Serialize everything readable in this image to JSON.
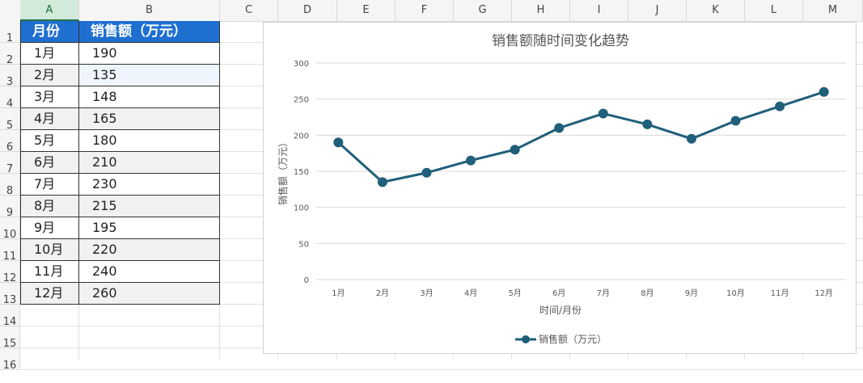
{
  "sheet": {
    "columns": [
      "A",
      "B",
      "C",
      "D",
      "E",
      "F",
      "G",
      "H",
      "I",
      "J",
      "K",
      "L",
      "M"
    ],
    "rows": [
      "1",
      "2",
      "3",
      "4",
      "5",
      "6",
      "7",
      "8",
      "9",
      "10",
      "11",
      "12",
      "13",
      "14",
      "15",
      "16"
    ],
    "selected_column": "A"
  },
  "table": {
    "headers": [
      "月份",
      "销售额（万元）"
    ],
    "rows": [
      [
        "1月",
        "190"
      ],
      [
        "2月",
        "135"
      ],
      [
        "3月",
        "148"
      ],
      [
        "4月",
        "165"
      ],
      [
        "5月",
        "180"
      ],
      [
        "6月",
        "210"
      ],
      [
        "7月",
        "230"
      ],
      [
        "8月",
        "215"
      ],
      [
        "9月",
        "195"
      ],
      [
        "10月",
        "220"
      ],
      [
        "11月",
        "240"
      ],
      [
        "12月",
        "260"
      ]
    ]
  },
  "chart_data": {
    "type": "line",
    "title": "销售额随时间变化趋势",
    "xlabel": "时间/月份",
    "ylabel": "销售额（万元）",
    "categories": [
      "1月",
      "2月",
      "3月",
      "4月",
      "5月",
      "6月",
      "7月",
      "8月",
      "9月",
      "10月",
      "11月",
      "12月"
    ],
    "series": [
      {
        "name": "销售额（万元）",
        "values": [
          190,
          135,
          148,
          165,
          180,
          210,
          230,
          215,
          195,
          220,
          240,
          260
        ],
        "color": "#1f5f7a"
      }
    ],
    "ylim": [
      0,
      300
    ],
    "yticks": [
      "0",
      "50",
      "100",
      "150",
      "200",
      "250",
      "300"
    ],
    "grid": true,
    "legend": "bottom"
  },
  "colors": {
    "header_fill": "#1f6fd1",
    "line": "#1f5f7a",
    "selected_col": "#d2ead9"
  }
}
